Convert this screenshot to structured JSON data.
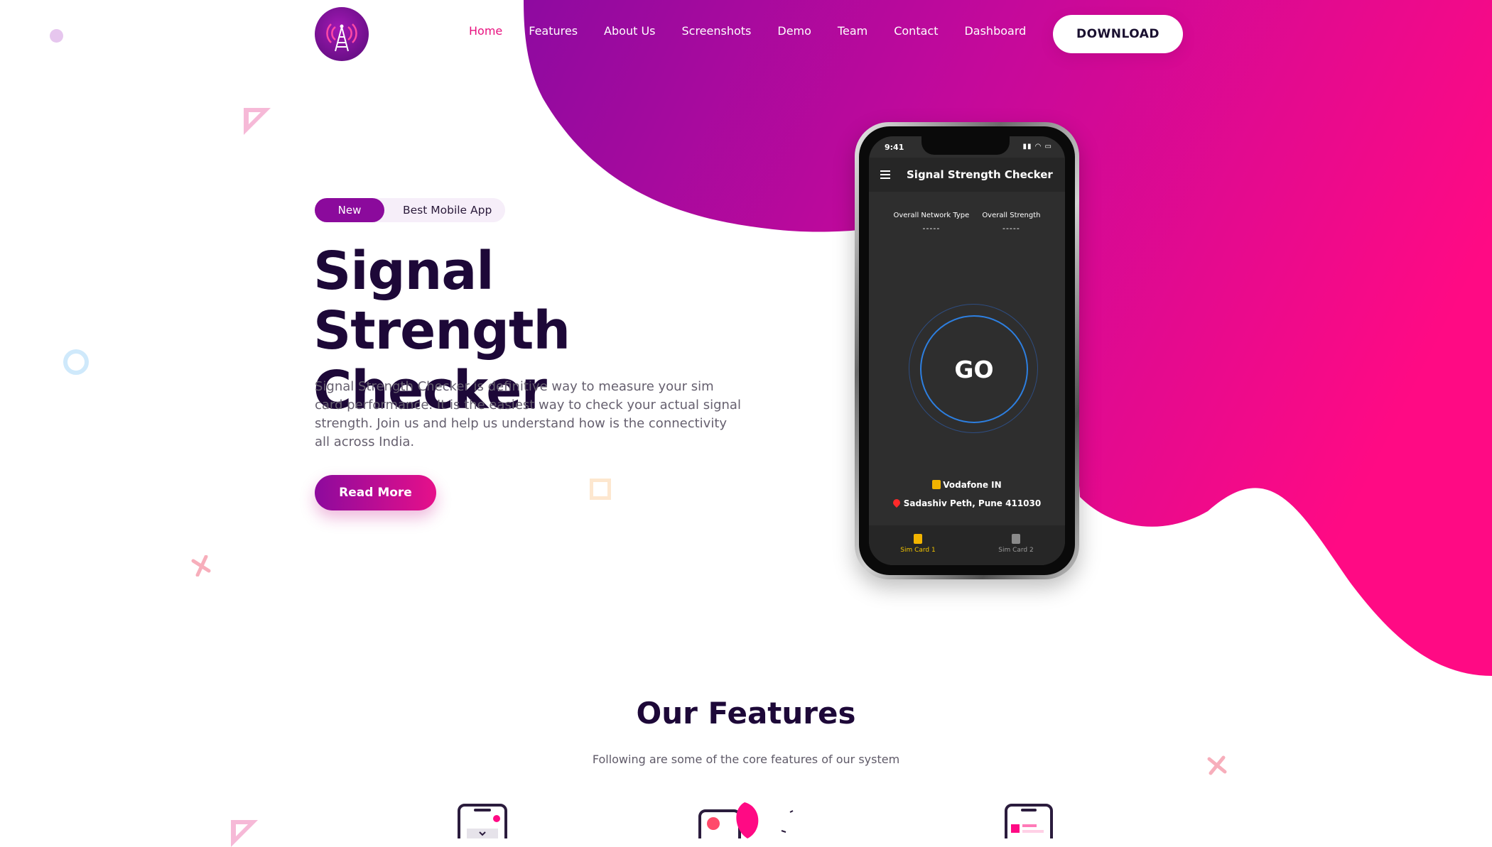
{
  "nav": {
    "logo_icon": "signal-tower-icon",
    "items": [
      {
        "label": "Home",
        "active": true
      },
      {
        "label": "Features",
        "active": false
      },
      {
        "label": "About Us",
        "active": false
      },
      {
        "label": "Screenshots",
        "active": false
      },
      {
        "label": "Demo",
        "active": false
      },
      {
        "label": "Team",
        "active": false
      },
      {
        "label": "Contact",
        "active": false
      },
      {
        "label": "Dashboard",
        "active": false
      }
    ],
    "download_label": "DOWNLOAD"
  },
  "hero": {
    "badge_new": "New",
    "badge_text": "Best Mobile App",
    "title": "Signal Strength Checker",
    "description": "Signal Strength Checker is definitive way to measure your sim card performance. It is the easiest way to check your actual signal strength. Join us and help us understand how is the connectivity all across India.",
    "read_more_label": "Read More"
  },
  "phone": {
    "status_time": "9:41",
    "app_title": "Signal Strength Checker",
    "stats": [
      {
        "label": "Overall Network Type",
        "value": "-----"
      },
      {
        "label": "Overall Strength",
        "value": "-----"
      }
    ],
    "go_label": "GO",
    "operator": "Vodafone IN",
    "location": "Sadashiv Peth, Pune 411030",
    "tabs": [
      {
        "label": "Sim Card 1",
        "active": true
      },
      {
        "label": "Sim Card 2",
        "active": false
      }
    ]
  },
  "features": {
    "title": "Our Features",
    "subtitle": "Following are some of the core features of our system"
  },
  "colors": {
    "accent_purple": "#8b0a9c",
    "accent_pink": "#ff0a84",
    "nav_active": "#e8117f",
    "title_dark": "#1d0838"
  }
}
